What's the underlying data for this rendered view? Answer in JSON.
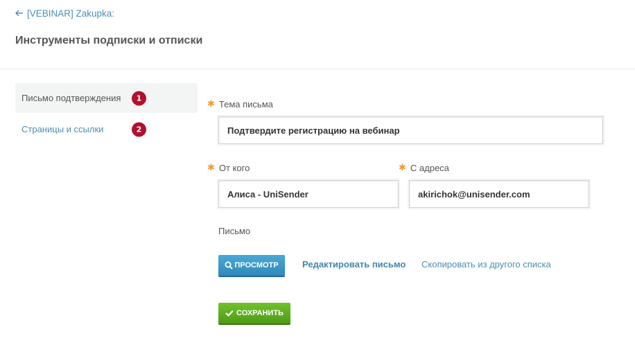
{
  "header": {
    "back_label": "[VEBINAR] Zakupka:",
    "title": "Инструменты подписки и отписки"
  },
  "sidebar": {
    "items": [
      {
        "label": "Письмо подтверждения",
        "number": "1",
        "active": true
      },
      {
        "label": "Страницы и ссылки",
        "number": "2",
        "active": false
      }
    ]
  },
  "form": {
    "subject": {
      "label": "Тема письма",
      "value": "Подтвердите регистрацию на вебинар"
    },
    "from_name": {
      "label": "От кого",
      "value": "Алиса - UniSender"
    },
    "from_email": {
      "label": "С адреса",
      "value": "akirichok@unisender.com"
    },
    "letter_label": "Письмо",
    "preview_button": "ПРОСМОТР",
    "edit_link": "Редактировать письмо",
    "copy_link": "Скопировать из другого списка",
    "save_button": "СОХРАНИТЬ"
  },
  "colors": {
    "link": "#4b8fb3",
    "badge": "#b2112e",
    "required_star": "#f39c34",
    "preview_button": "#2f89b8",
    "save_button": "#4e9a17"
  },
  "icons": {
    "back": "arrow-left-icon",
    "preview": "magnifier-icon",
    "save": "check-icon",
    "required": "asterisk-icon"
  }
}
